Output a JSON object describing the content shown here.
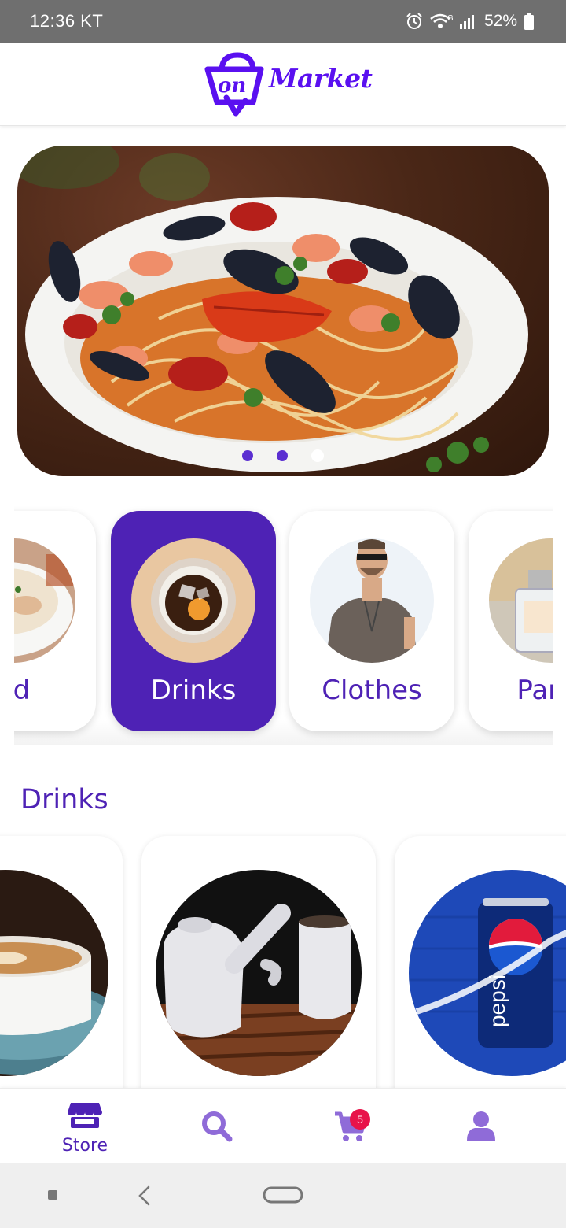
{
  "status_bar": {
    "time": "12:36 KT",
    "battery": "52%",
    "network": "G",
    "icons": [
      "alarm-icon",
      "wifi-icon",
      "signal-icon",
      "battery-icon"
    ]
  },
  "header": {
    "logo_text": "Market",
    "logo_prefix": "on"
  },
  "hero": {
    "slide_count": 3,
    "active_slide": 3
  },
  "categories": [
    {
      "label": "od",
      "image": "food-bowl"
    },
    {
      "label": "Drinks",
      "image": "iced-drink",
      "selected": true
    },
    {
      "label": "Clothes",
      "image": "man-in-tshirt"
    },
    {
      "label": "Parfu",
      "image": "perfume-bottle"
    }
  ],
  "section": {
    "title": "Drinks"
  },
  "products": [
    {
      "image": "coffee-cup"
    },
    {
      "image": "teapot-and-cup"
    },
    {
      "image": "pepsi-can"
    }
  ],
  "bottom_nav": {
    "items": [
      {
        "label": "Store",
        "icon": "store-icon",
        "active": true
      },
      {
        "label": "",
        "icon": "search-icon"
      },
      {
        "label": "",
        "icon": "cart-icon",
        "badge": "5"
      },
      {
        "label": "",
        "icon": "user-icon"
      }
    ]
  },
  "colors": {
    "primary": "#4e22b5",
    "logo": "#5a10f0",
    "badge": "#e8134a",
    "status_bar": "#6f6f6f"
  }
}
